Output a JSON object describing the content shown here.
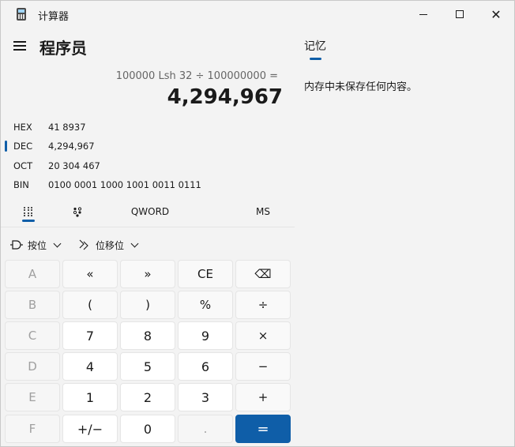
{
  "window": {
    "title": "计算器",
    "controls": {
      "minimize": "—",
      "maximize": "□",
      "close": "✕"
    }
  },
  "header": {
    "mode": "程序员"
  },
  "display": {
    "expression": "100000 Lsh 32 ÷ 100000000 =",
    "result": "4,294,967"
  },
  "radix": [
    {
      "label": "HEX",
      "value": "41 8937",
      "selected": false
    },
    {
      "label": "DEC",
      "value": "4,294,967",
      "selected": true
    },
    {
      "label": "OCT",
      "value": "20 304 467",
      "selected": false
    },
    {
      "label": "BIN",
      "value": "0100 0001 1000 1001 0011 0111",
      "selected": false
    }
  ],
  "tabs": {
    "word_size": "QWORD",
    "memory_store": "MS"
  },
  "dropdowns": {
    "bitwise": "按位",
    "bitshift": "位移位"
  },
  "keypad": [
    [
      {
        "label": "A",
        "state": "disabled"
      },
      {
        "label": "«",
        "state": "op"
      },
      {
        "label": "»",
        "state": "op"
      },
      {
        "label": "CE",
        "state": "op"
      },
      {
        "label": "⌫",
        "state": "op"
      }
    ],
    [
      {
        "label": "B",
        "state": "disabled"
      },
      {
        "label": "(",
        "state": "op"
      },
      {
        "label": ")",
        "state": "op"
      },
      {
        "label": "%",
        "state": "op"
      },
      {
        "label": "÷",
        "state": "op"
      }
    ],
    [
      {
        "label": "C",
        "state": "disabled"
      },
      {
        "label": "7",
        "state": "num"
      },
      {
        "label": "8",
        "state": "num"
      },
      {
        "label": "9",
        "state": "num"
      },
      {
        "label": "×",
        "state": "op"
      }
    ],
    [
      {
        "label": "D",
        "state": "disabled"
      },
      {
        "label": "4",
        "state": "num"
      },
      {
        "label": "5",
        "state": "num"
      },
      {
        "label": "6",
        "state": "num"
      },
      {
        "label": "−",
        "state": "op"
      }
    ],
    [
      {
        "label": "E",
        "state": "disabled"
      },
      {
        "label": "1",
        "state": "num"
      },
      {
        "label": "2",
        "state": "num"
      },
      {
        "label": "3",
        "state": "num"
      },
      {
        "label": "+",
        "state": "op"
      }
    ],
    [
      {
        "label": "F",
        "state": "disabled"
      },
      {
        "label": "+/−",
        "state": "num"
      },
      {
        "label": "0",
        "state": "num"
      },
      {
        "label": ".",
        "state": "disabled"
      },
      {
        "label": "=",
        "state": "equals"
      }
    ]
  ],
  "memory": {
    "tab": "记忆",
    "empty_message": "内存中未保存任何内容。"
  },
  "colors": {
    "accent": "#0f5ea8",
    "background": "#f3f3f3"
  }
}
